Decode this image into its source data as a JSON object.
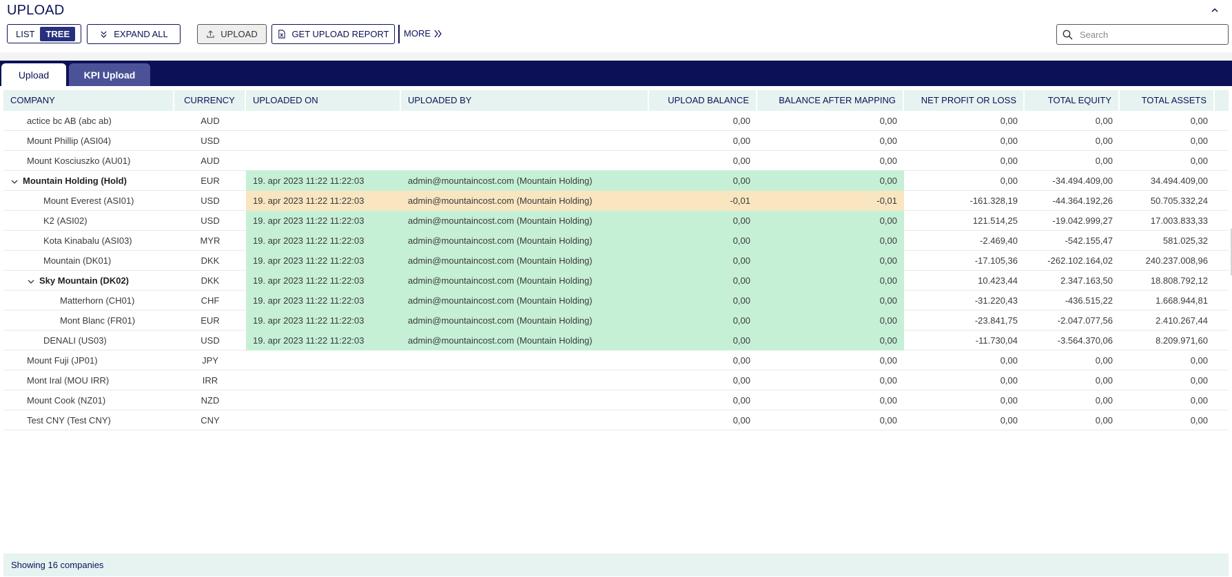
{
  "page": {
    "title": "UPLOAD"
  },
  "toolbar": {
    "list_label": "LIST",
    "tree_label": "TREE",
    "expand_all_label": "EXPAND ALL",
    "upload_label": "UPLOAD",
    "report_label": "GET UPLOAD REPORT",
    "more_label": "MORE",
    "search_placeholder": "Search"
  },
  "tabs": [
    {
      "label": "Upload",
      "active": true
    },
    {
      "label": "KPI Upload",
      "active": false
    }
  ],
  "columns": [
    "COMPANY",
    "CURRENCY",
    "UPLOADED ON",
    "UPLOADED BY",
    "UPLOAD BALANCE",
    "BALANCE AFTER MAPPING",
    "NET PROFIT OR LOSS",
    "TOTAL EQUITY",
    "TOTAL ASSETS"
  ],
  "rows": [
    {
      "company": "actice bc AB (abc ab)",
      "currency": "AUD",
      "uploaded_on": "",
      "uploaded_by": "",
      "upload_balance": "0,00",
      "balance_after_mapping": "0,00",
      "net_profit": "0,00",
      "total_equity": "0,00",
      "total_assets": "0,00",
      "level": 1,
      "expandable": false,
      "bold": false,
      "status": "none"
    },
    {
      "company": "Mount Phillip (ASI04)",
      "currency": "USD",
      "uploaded_on": "",
      "uploaded_by": "",
      "upload_balance": "0,00",
      "balance_after_mapping": "0,00",
      "net_profit": "0,00",
      "total_equity": "0,00",
      "total_assets": "0,00",
      "level": 1,
      "expandable": false,
      "bold": false,
      "status": "none"
    },
    {
      "company": "Mount Kosciuszko (AU01)",
      "currency": "AUD",
      "uploaded_on": "",
      "uploaded_by": "",
      "upload_balance": "0,00",
      "balance_after_mapping": "0,00",
      "net_profit": "0,00",
      "total_equity": "0,00",
      "total_assets": "0,00",
      "level": 1,
      "expandable": false,
      "bold": false,
      "status": "none"
    },
    {
      "company": "Mountain Holding (Hold)",
      "currency": "EUR",
      "uploaded_on": "19. apr 2023 11:22 11:22:03",
      "uploaded_by": "admin@mountaincost.com (Mountain Holding)",
      "upload_balance": "0,00",
      "balance_after_mapping": "0,00",
      "net_profit": "0,00",
      "total_equity": "-34.494.409,00",
      "total_assets": "34.494.409,00",
      "level": 1,
      "expandable": true,
      "bold": true,
      "status": "ok"
    },
    {
      "company": "Mount Everest (ASI01)",
      "currency": "USD",
      "uploaded_on": "19. apr 2023 11:22 11:22:03",
      "uploaded_by": "admin@mountaincost.com (Mountain Holding)",
      "upload_balance": "-0,01",
      "balance_after_mapping": "-0,01",
      "net_profit": "-161.328,19",
      "total_equity": "-44.364.192,26",
      "total_assets": "50.705.332,24",
      "level": 2,
      "expandable": false,
      "bold": false,
      "status": "warn"
    },
    {
      "company": "K2 (ASI02)",
      "currency": "USD",
      "uploaded_on": "19. apr 2023 11:22 11:22:03",
      "uploaded_by": "admin@mountaincost.com (Mountain Holding)",
      "upload_balance": "0,00",
      "balance_after_mapping": "0,00",
      "net_profit": "121.514,25",
      "total_equity": "-19.042.999,27",
      "total_assets": "17.003.833,33",
      "level": 2,
      "expandable": false,
      "bold": false,
      "status": "ok"
    },
    {
      "company": "Kota Kinabalu (ASI03)",
      "currency": "MYR",
      "uploaded_on": "19. apr 2023 11:22 11:22:03",
      "uploaded_by": "admin@mountaincost.com (Mountain Holding)",
      "upload_balance": "0,00",
      "balance_after_mapping": "0,00",
      "net_profit": "-2.469,40",
      "total_equity": "-542.155,47",
      "total_assets": "581.025,32",
      "level": 2,
      "expandable": false,
      "bold": false,
      "status": "ok"
    },
    {
      "company": "Mountain (DK01)",
      "currency": "DKK",
      "uploaded_on": "19. apr 2023 11:22 11:22:03",
      "uploaded_by": "admin@mountaincost.com (Mountain Holding)",
      "upload_balance": "0,00",
      "balance_after_mapping": "0,00",
      "net_profit": "-17.105,36",
      "total_equity": "-262.102.164,02",
      "total_assets": "240.237.008,96",
      "level": 2,
      "expandable": false,
      "bold": false,
      "status": "ok"
    },
    {
      "company": "Sky Mountain (DK02)",
      "currency": "DKK",
      "uploaded_on": "19. apr 2023 11:22 11:22:03",
      "uploaded_by": "admin@mountaincost.com (Mountain Holding)",
      "upload_balance": "0,00",
      "balance_after_mapping": "0,00",
      "net_profit": "10.423,44",
      "total_equity": "2.347.163,50",
      "total_assets": "18.808.792,12",
      "level": 2,
      "expandable": true,
      "bold": true,
      "status": "ok"
    },
    {
      "company": "Matterhorn (CH01)",
      "currency": "CHF",
      "uploaded_on": "19. apr 2023 11:22 11:22:03",
      "uploaded_by": "admin@mountaincost.com (Mountain Holding)",
      "upload_balance": "0,00",
      "balance_after_mapping": "0,00",
      "net_profit": "-31.220,43",
      "total_equity": "-436.515,22",
      "total_assets": "1.668.944,81",
      "level": 3,
      "expandable": false,
      "bold": false,
      "status": "ok"
    },
    {
      "company": "Mont Blanc (FR01)",
      "currency": "EUR",
      "uploaded_on": "19. apr 2023 11:22 11:22:03",
      "uploaded_by": "admin@mountaincost.com (Mountain Holding)",
      "upload_balance": "0,00",
      "balance_after_mapping": "0,00",
      "net_profit": "-23.841,75",
      "total_equity": "-2.047.077,56",
      "total_assets": "2.410.267,44",
      "level": 3,
      "expandable": false,
      "bold": false,
      "status": "ok"
    },
    {
      "company": "DENALI (US03)",
      "currency": "USD",
      "uploaded_on": "19. apr 2023 11:22 11:22:03",
      "uploaded_by": "admin@mountaincost.com (Mountain Holding)",
      "upload_balance": "0,00",
      "balance_after_mapping": "0,00",
      "net_profit": "-11.730,04",
      "total_equity": "-3.564.370,06",
      "total_assets": "8.209.971,60",
      "level": 2,
      "expandable": false,
      "bold": false,
      "status": "ok"
    },
    {
      "company": "Mount Fuji (JP01)",
      "currency": "JPY",
      "uploaded_on": "",
      "uploaded_by": "",
      "upload_balance": "0,00",
      "balance_after_mapping": "0,00",
      "net_profit": "0,00",
      "total_equity": "0,00",
      "total_assets": "0,00",
      "level": 1,
      "expandable": false,
      "bold": false,
      "status": "none"
    },
    {
      "company": "Mont Iral (MOU IRR)",
      "currency": "IRR",
      "uploaded_on": "",
      "uploaded_by": "",
      "upload_balance": "0,00",
      "balance_after_mapping": "0,00",
      "net_profit": "0,00",
      "total_equity": "0,00",
      "total_assets": "0,00",
      "level": 1,
      "expandable": false,
      "bold": false,
      "status": "none"
    },
    {
      "company": "Mount Cook (NZ01)",
      "currency": "NZD",
      "uploaded_on": "",
      "uploaded_by": "",
      "upload_balance": "0,00",
      "balance_after_mapping": "0,00",
      "net_profit": "0,00",
      "total_equity": "0,00",
      "total_assets": "0,00",
      "level": 1,
      "expandable": false,
      "bold": false,
      "status": "none"
    },
    {
      "company": "Test CNY (Test CNY)",
      "currency": "CNY",
      "uploaded_on": "",
      "uploaded_by": "",
      "upload_balance": "0,00",
      "balance_after_mapping": "0,00",
      "net_profit": "0,00",
      "total_equity": "0,00",
      "total_assets": "0,00",
      "level": 1,
      "expandable": false,
      "bold": false,
      "status": "none"
    }
  ],
  "footer": {
    "text": "Showing 16 companies"
  },
  "colors": {
    "navy": "#0c1157",
    "ok": "#c6f0d6",
    "warn": "#f9e5c0",
    "header_bg": "#e6f3f1"
  }
}
